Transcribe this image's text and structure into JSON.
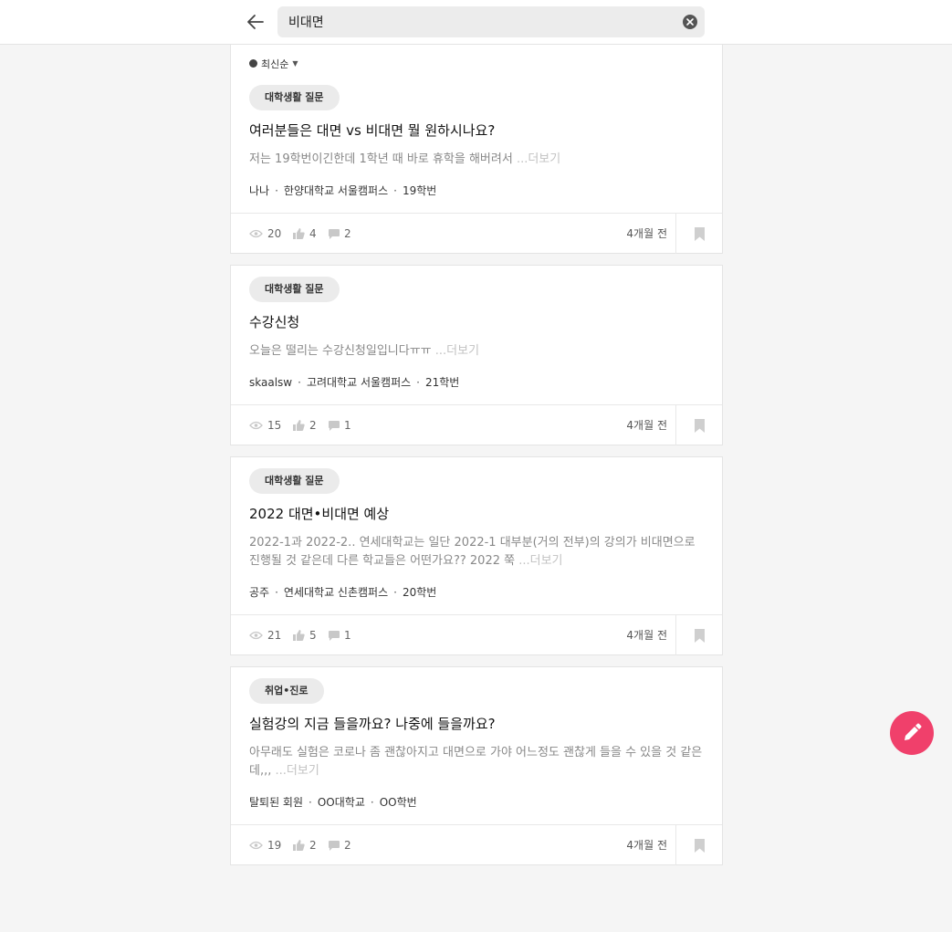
{
  "search": {
    "query": "비대면"
  },
  "sort": {
    "label": "최신순"
  },
  "posts": [
    {
      "category": "대학생활 질문",
      "title": "여러분들은 대면 vs 비대면 뭘 원하시나요?",
      "excerpt": "저는 19학번이긴한데 1학년 때 바로 휴학을 해버려서",
      "more": "...더보기",
      "author": "나나",
      "school": "한양대학교 서울캠퍼스",
      "year": "19학번",
      "views": "20",
      "likes": "4",
      "comments": "2",
      "time": "4개월 전"
    },
    {
      "category": "대학생활 질문",
      "title": "수강신청",
      "excerpt": "오늘은 떨리는 수강신청일입니다ㅠㅠ",
      "more": "...더보기",
      "author": "skaalsw",
      "school": "고려대학교 서울캠퍼스",
      "year": "21학번",
      "views": "15",
      "likes": "2",
      "comments": "1",
      "time": "4개월 전"
    },
    {
      "category": "대학생활 질문",
      "title": "2022 대면•비대면 예상",
      "excerpt": "2022-1과 2022-2.. 연세대학교는 일단 2022-1 대부분(거의 전부)의 강의가 비대면으로 진행될 것 같은데 다른 학교들은 어떤가요?? 2022 쭉",
      "more": "...더보기",
      "author": "공주",
      "school": "연세대학교 신촌캠퍼스",
      "year": "20학번",
      "views": "21",
      "likes": "5",
      "comments": "1",
      "time": "4개월 전"
    },
    {
      "category": "취업•진로",
      "title": "실험강의 지금 들을까요? 나중에 들을까요?",
      "excerpt": "아무래도 실험은 코로나 좀 괜찮아지고 대면으로 가야 어느정도 괜찮게 들을 수 있을 것 같은데,,,",
      "more": "...더보기",
      "author": "탈퇴된 회원",
      "school": "OO대학교",
      "year": "OO학번",
      "views": "19",
      "likes": "2",
      "comments": "2",
      "time": "4개월 전"
    }
  ],
  "icons": {
    "back": "arrow-left-icon",
    "clear": "clear-circle-icon",
    "views": "eye-icon",
    "likes": "thumbs-up-icon",
    "comments": "comment-icon",
    "bookmark": "bookmark-icon",
    "write": "pencil-icon"
  },
  "colors": {
    "accent": "#f0406b",
    "chip_bg": "#ebebeb"
  }
}
